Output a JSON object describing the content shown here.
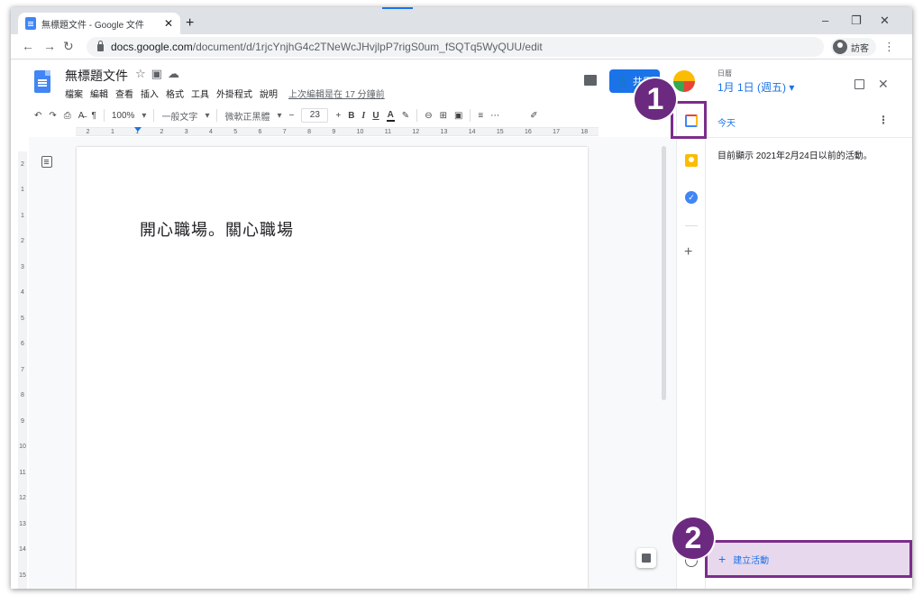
{
  "browser": {
    "tab_title": "無標題文件 - Google 文件",
    "tab_close": "✕",
    "new_tab": "+",
    "url_host": "docs.google.com",
    "url_path": "/document/d/1rjcYnjhG4c2TNeWcJHvjlpP7rigS0um_fSQTq5WyQUU/edit",
    "guest_label": "訪客",
    "minimize": "–",
    "maximize": "❐",
    "close": "✕"
  },
  "docs": {
    "title": "無標題文件",
    "menus": [
      "檔案",
      "編輯",
      "查看",
      "插入",
      "格式",
      "工具",
      "外掛程式",
      "說明"
    ],
    "last_edit": "上次編輯是在 17 分鐘前",
    "share_label": "共用"
  },
  "toolbar": {
    "zoom": "100%",
    "style": "一般文字",
    "font": "微軟正黑體",
    "font_size": "23"
  },
  "document": {
    "body_text": "開心職場。關心職場"
  },
  "calendar_panel": {
    "header_label": "日曆",
    "date": "1月 1日 (週五) ▾",
    "today": "今天",
    "message": "目前顯示 2021年2月24日以前的活動。",
    "create_event": "建立活動"
  },
  "annotations": {
    "badge1": "1",
    "badge2": "2",
    "color": "#6b2a7f"
  },
  "icons": [
    "docs-logo-icon",
    "star-icon",
    "folder-icon",
    "cloud-icon",
    "comment-icon",
    "calendar-icon",
    "keep-icon",
    "tasks-icon",
    "add-icon",
    "outline-icon",
    "explore-icon"
  ]
}
